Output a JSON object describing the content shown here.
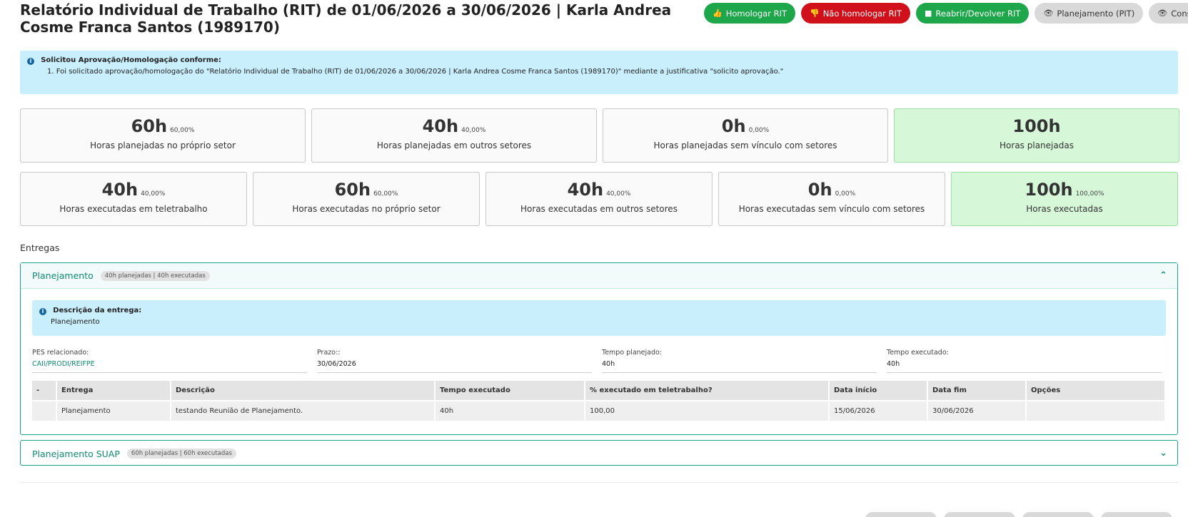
{
  "header": {
    "title": "Relatório Individual de Trabalho (RIT) de 01/06/2026 a 30/06/2026 | Karla Andrea Cosme Franca Santos (1989170)",
    "actions": [
      {
        "label": "Homologar RIT",
        "icon": "thumbs-up-icon",
        "color": "#1ea64a"
      },
      {
        "label": "Não homologar RIT",
        "icon": "thumbs-down-icon",
        "color": "#d0111b"
      },
      {
        "label": "Reabrir/Devolver RIT",
        "icon": "square-icon",
        "color": "#1ea64a"
      },
      {
        "label": "Planejamento (PIT)",
        "icon": "eye-icon"
      },
      {
        "label": "Consultas",
        "icon": "eye-icon"
      }
    ]
  },
  "alert": {
    "title": "Solicitou Aprovação/Homologação conforme:",
    "item": "1. Foi solicitado aprovação/homologação do \"Relatório Individual de Trabalho (RIT) de 01/06/2026 a 30/06/2026 | Karla Andrea Cosme Franca Santos (1989170)\" mediante a justificativa \"solicito aprovação.\""
  },
  "planned": [
    {
      "hours": "60h",
      "pct": "60,00%",
      "label": "Horas planejadas no próprio setor"
    },
    {
      "hours": "40h",
      "pct": "40,00%",
      "label": "Horas planejadas em outros setores"
    },
    {
      "hours": "0h",
      "pct": "0,00%",
      "label": "Horas planejadas sem vínculo com setores"
    },
    {
      "hours": "100h",
      "pct": "",
      "label": "Horas planejadas"
    }
  ],
  "executed": [
    {
      "hours": "40h",
      "pct": "40,00%",
      "label": "Horas executadas em teletrabalho"
    },
    {
      "hours": "60h",
      "pct": "60,00%",
      "label": "Horas executadas no próprio setor"
    },
    {
      "hours": "40h",
      "pct": "40,00%",
      "label": "Horas executadas em outros setores"
    },
    {
      "hours": "0h",
      "pct": "0,00%",
      "label": "Horas executadas sem vínculo com setores"
    },
    {
      "hours": "100h",
      "pct": "100,00%",
      "label": "Horas executadas"
    }
  ],
  "entregas": {
    "title": "Entregas",
    "items": [
      {
        "name": "Planejamento",
        "badge": "40h planejadas | 40h executadas",
        "desc_title": "Descrição da entrega:",
        "desc_value": "Planejamento",
        "fields": [
          {
            "label": "PES relacionado:",
            "value": "CAII/PRODI/REIFPE"
          },
          {
            "label": "Prazo::",
            "value": "30/06/2026"
          },
          {
            "label": "Tempo planejado:",
            "value": "40h"
          },
          {
            "label": "Tempo executado:",
            "value": "40h"
          }
        ],
        "table": {
          "headers": [
            "-",
            "Entrega",
            "Descrição",
            "Tempo executado",
            "% executado em teletrabalho?",
            "Data início",
            "Data fim",
            "Opções"
          ],
          "rows": [
            [
              "",
              "Planejamento",
              "testando Reunião de Planejamento.",
              "40h",
              "100,00",
              "15/06/2026",
              "30/06/2026",
              ""
            ]
          ]
        }
      },
      {
        "name": "Planejamento SUAP",
        "badge": "60h planejadas | 60h executadas"
      }
    ]
  },
  "colors": {
    "success": "#1ea64a",
    "danger": "#d0111b",
    "info_bg": "#c9eefc",
    "teal": "#0f8a74",
    "card_green": "#d6f8d8"
  }
}
